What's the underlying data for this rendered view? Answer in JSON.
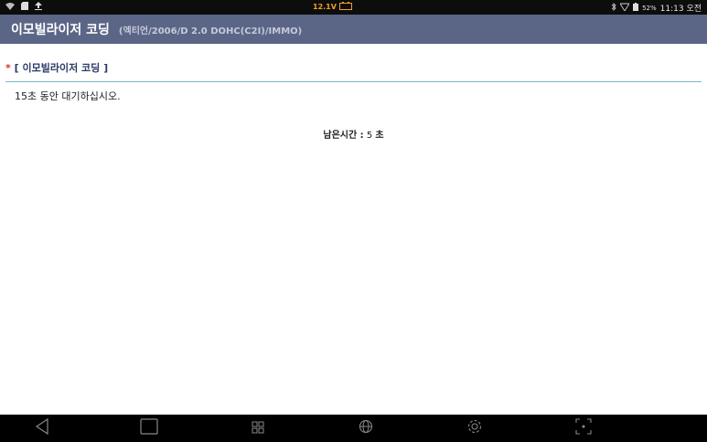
{
  "status_bar": {
    "voltage": "12.1V",
    "battery": "52%",
    "time": "11:13 오전",
    "icons": [
      "wifi-icon",
      "sd-card-icon",
      "upload-icon",
      "battery-charge-icon",
      "bluetooth-icon",
      "signal-icon",
      "battery-icon"
    ]
  },
  "header": {
    "title": "이모빌라이저 코딩",
    "subtitle": "(엑티언/2006/D 2.0 DOHC(C2I)/IMMO)"
  },
  "section": {
    "marker": "*",
    "title": "[ 이모빌라이저 코딩 ]"
  },
  "content": {
    "message": "15초 동안 대기하십시오.",
    "timer_label": "남은시간 :",
    "timer_value": "5",
    "timer_unit": "초"
  },
  "nav_bar": {
    "buttons": [
      "back-icon",
      "home-icon",
      "apps-grid-icon",
      "globe-icon",
      "settings-gear-icon",
      "screen-capture-icon"
    ]
  },
  "colors": {
    "header_bg": "#5b6687",
    "status_bar_bg": "#0d0d0d",
    "voltage_color": "#f0a020",
    "section_divider": "#7ab9c9"
  }
}
